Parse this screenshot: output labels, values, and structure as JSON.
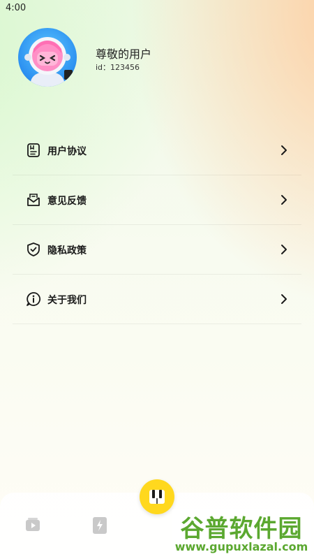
{
  "status_bar": {
    "time": "4:00"
  },
  "profile": {
    "name": "尊敬的用户",
    "id_text": "id：123456",
    "avatar_icon": "astronaut-avatar"
  },
  "menu": {
    "items": [
      {
        "label": "用户协议",
        "icon": "document-icon"
      },
      {
        "label": "意见反馈",
        "icon": "feedback-icon"
      },
      {
        "label": "隐私政策",
        "icon": "shield-check-icon"
      },
      {
        "label": "关于我们",
        "icon": "info-icon"
      }
    ]
  },
  "bottom_nav": {
    "items": [
      {
        "icon": "video-icon"
      },
      {
        "icon": "lightning-icon"
      },
      {
        "icon": "piano-keys-icon"
      }
    ]
  },
  "watermark": {
    "title": "谷普软件园",
    "url": "www.gupuxlazal.com"
  },
  "colors": {
    "accent": "#ffd81e",
    "watermark": "#5ba830",
    "text": "#1a1a1a"
  }
}
